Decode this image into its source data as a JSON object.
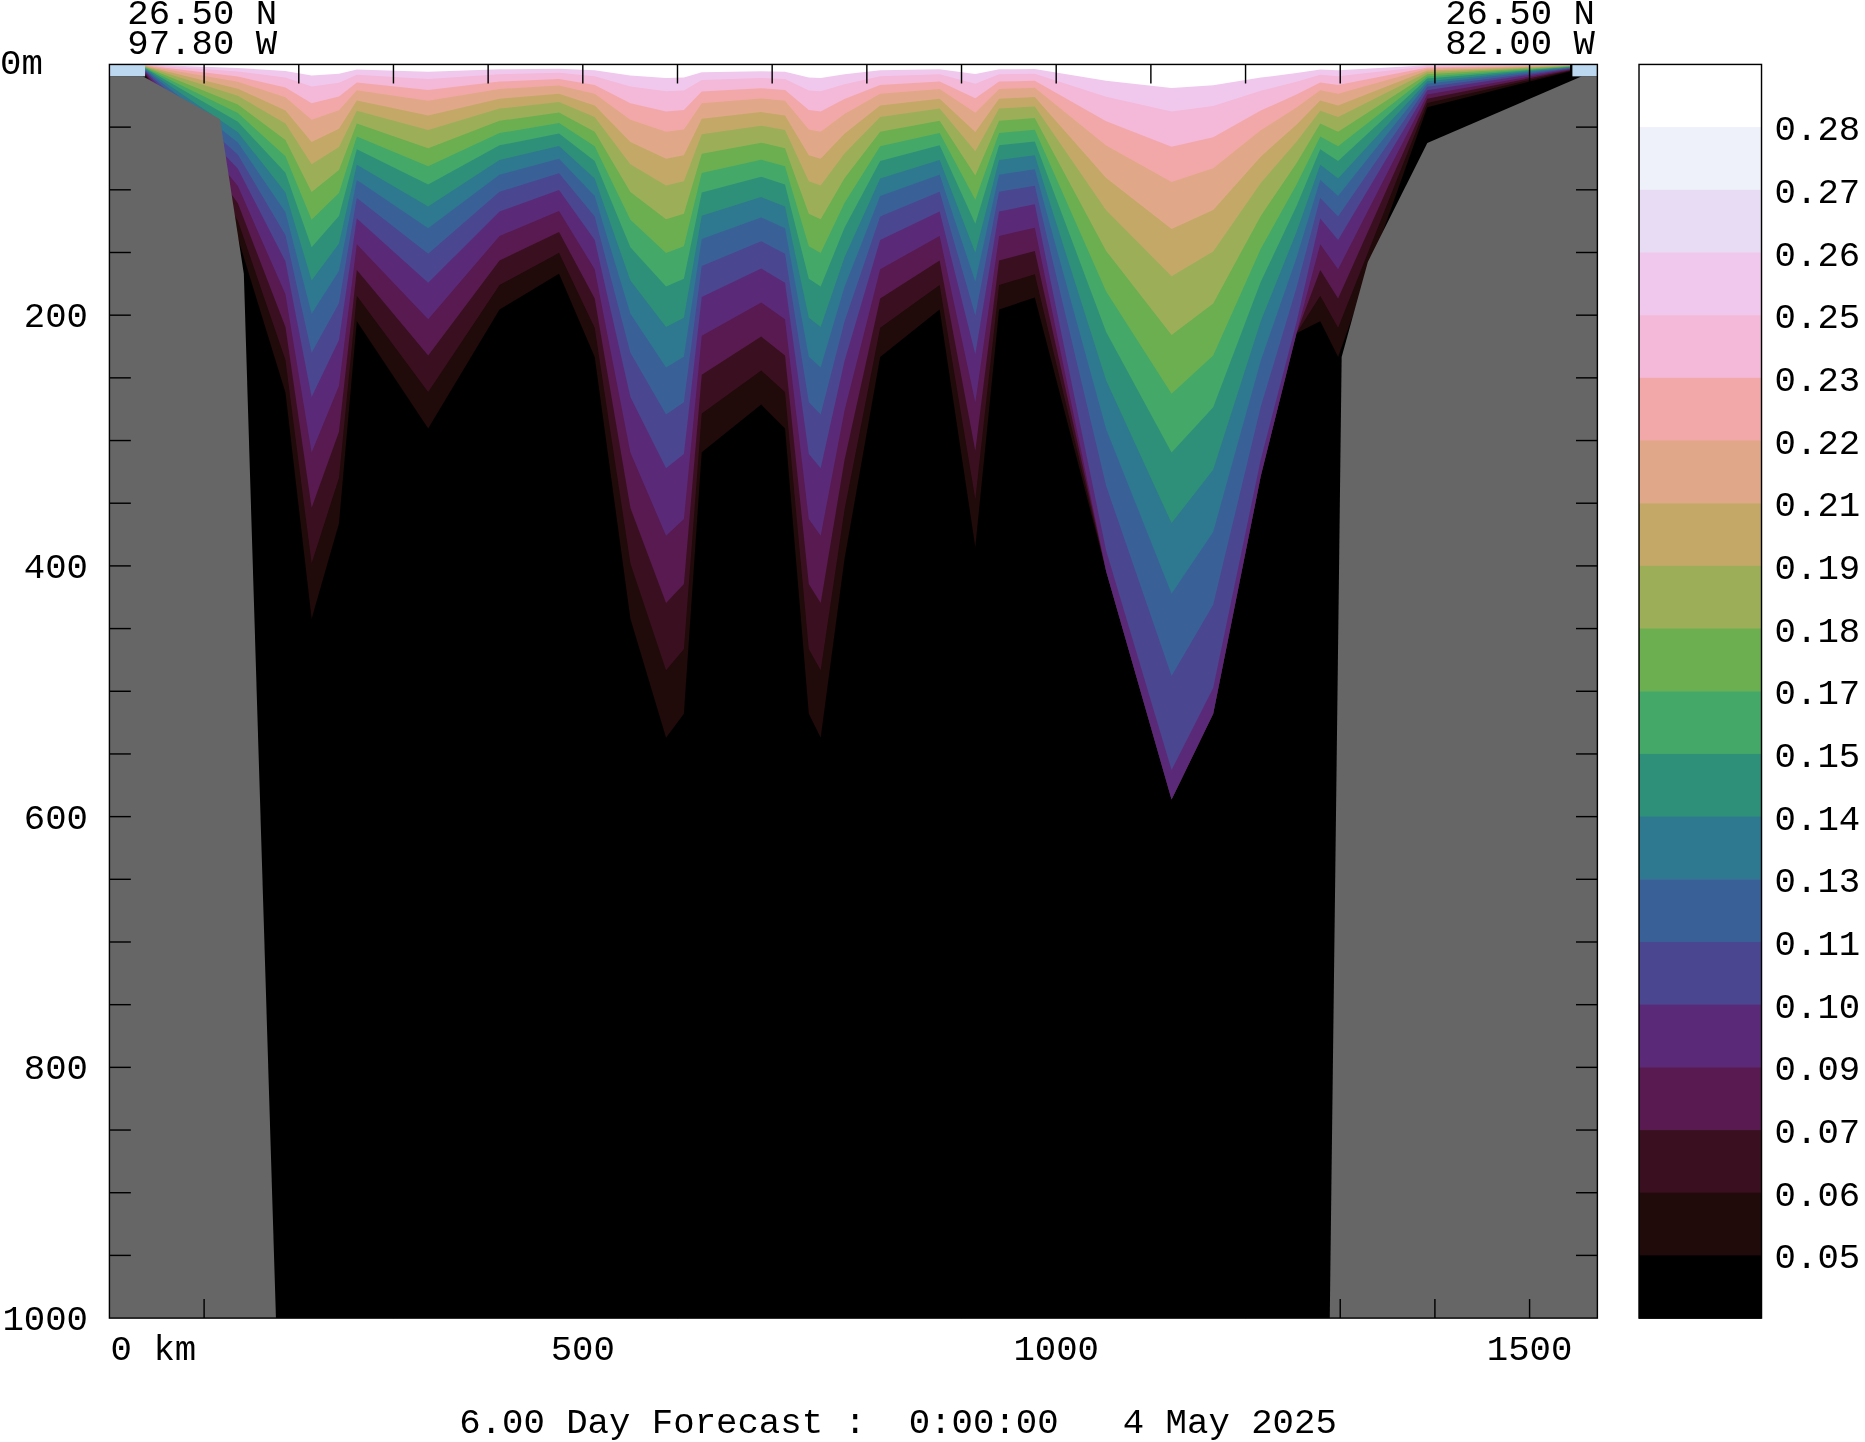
{
  "header": {
    "start_lat": "26.50 N",
    "start_lon": "97.80 W",
    "end_lat": "26.50 N",
    "end_lon": "82.00 W"
  },
  "y_axis_labels": [
    "0m",
    "200",
    "400",
    "600",
    "800",
    "1000"
  ],
  "x_axis_labels": [
    "0 km",
    "500",
    "1000",
    "1500"
  ],
  "colorbar_labels": [
    "0.28",
    "0.27",
    "0.26",
    "0.25",
    "0.23",
    "0.22",
    "0.21",
    "0.19",
    "0.18",
    "0.17",
    "0.15",
    "0.14",
    "0.13",
    "0.11",
    "0.10",
    "0.09",
    "0.07",
    "0.06",
    "0.05"
  ],
  "caption": "6.00 Day Forecast :  0:00:00   4 May 2025"
}
